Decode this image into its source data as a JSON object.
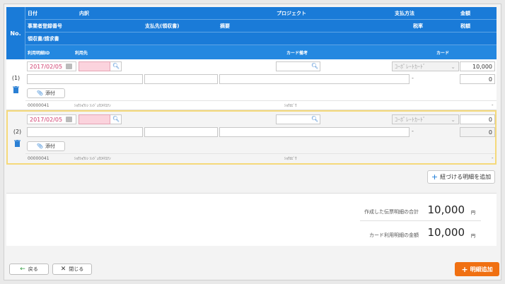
{
  "header": {
    "no": "No.",
    "row1": [
      "日付",
      "内訳",
      "プロジェクト",
      "支払方法",
      "金額"
    ],
    "row2": [
      "事業者登録番号",
      "支払先(領収書)",
      "摘要",
      "税率",
      "税額"
    ],
    "row3": [
      "領収書/請求書"
    ],
    "row4": [
      "利用明細ID",
      "利用先",
      "カード備考",
      "カード"
    ]
  },
  "items": [
    {
      "num": "(1)",
      "date": "2017/02/05",
      "payment": "ｺｰﾎﾟﾚｰﾄｶｰﾄﾞ",
      "amount": "10,000",
      "sub": "-",
      "tax": "0",
      "attach": "添付",
      "detail_id": "00000041",
      "use_place": "ｼｮｳｼｮｳｼﾝ ｼﾝｼﾞｭｸｴｷﾏｴﾃﾝ",
      "card_note": "ｼｮｳﾋﾋﾞｳ",
      "card_last": "-"
    },
    {
      "num": "(2)",
      "date": "2017/02/05",
      "payment": "ｺｰﾎﾟﾚｰﾄｶｰﾄﾞ",
      "amount": "0",
      "sub": "-",
      "tax": "0",
      "attach": "添付",
      "detail_id": "00000041",
      "use_place": "ｼｮｳｼｮｳｼﾝ ｼﾝｼﾞｭｸｴｷﾏｴﾃﾝ",
      "card_note": "ｼｮｳﾋﾋﾞｳ",
      "card_last": "-"
    }
  ],
  "add_linked_label": "紐づける明細を追加",
  "totals": {
    "created_label": "作成した伝票明細の合計",
    "created_value": "10,000",
    "card_label": "カード利用明細の金額",
    "card_value": "10,000",
    "unit": "円"
  },
  "footer": {
    "back": "戻る",
    "close": "閉じる",
    "add": "明細追加"
  },
  "colors": {
    "header_bg": "#1a7bd8",
    "accent_orange": "#f07012",
    "selected_border": "#f5d97a",
    "required_pink": "#fbd3dd"
  }
}
